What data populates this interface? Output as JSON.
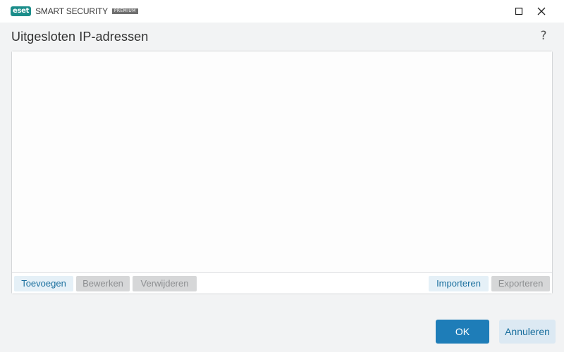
{
  "titlebar": {
    "logo_text": "eset",
    "product_name": "SMART SECURITY",
    "edition": "PREMIUM"
  },
  "icons": {
    "maximize": "maximize-icon",
    "close": "close-icon",
    "help": "help-icon"
  },
  "page": {
    "title": "Uitgesloten IP-adressen",
    "help_glyph": "?"
  },
  "list": {
    "items": []
  },
  "toolbar": {
    "add_label": "Toevoegen",
    "edit_label": "Bewerken",
    "remove_label": "Verwijderen",
    "import_label": "Importeren",
    "export_label": "Exporteren",
    "add_enabled": true,
    "edit_enabled": false,
    "remove_enabled": false,
    "import_enabled": true,
    "export_enabled": false
  },
  "footer": {
    "ok_label": "OK",
    "cancel_label": "Annuleren"
  },
  "colors": {
    "brand": "#1b8d8a",
    "accent": "#1e7db8",
    "link_text": "#1a6f9e",
    "disabled_bg": "#d6d7d8"
  }
}
